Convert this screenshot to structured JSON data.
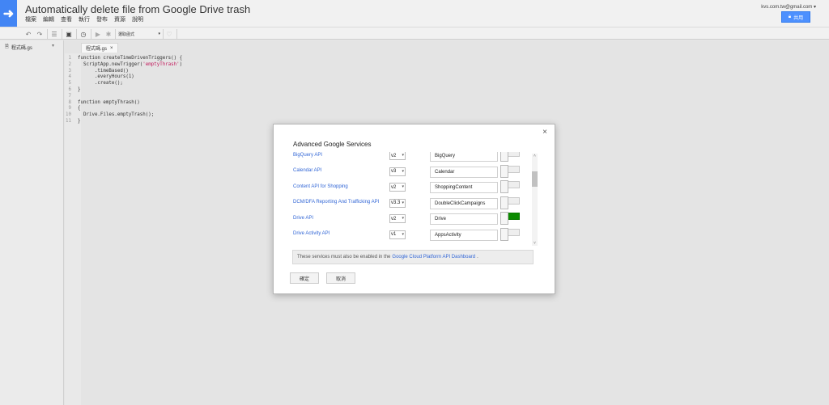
{
  "app": {
    "title": "Automatically delete file from Google Drive trash",
    "account": "kvs.com.tw@gmail.com",
    "share_label": "共用",
    "logo_icon": "arrow-right-icon",
    "brand_color": "#4285f4"
  },
  "menu": [
    "檔案",
    "編輯",
    "查看",
    "執行",
    "發布",
    "資源",
    "說明"
  ],
  "toolbar": {
    "function_select": "選取函式"
  },
  "sidebar": {
    "file_name": "程式碼.gs"
  },
  "editor": {
    "tab_label": "程式碼.gs",
    "tab_close": "×",
    "lines": [
      {
        "n": "1",
        "pre": "function createTimeDrivenTriggers() {",
        "str": "",
        "post": ""
      },
      {
        "n": "2",
        "pre": "  ScriptApp.newTrigger(",
        "str": "'emptyThrash'",
        "post": ")"
      },
      {
        "n": "3",
        "pre": "      .timeBased()",
        "str": "",
        "post": ""
      },
      {
        "n": "4",
        "pre": "      .everyHours(1)",
        "str": "",
        "post": ""
      },
      {
        "n": "5",
        "pre": "      .create();",
        "str": "",
        "post": ""
      },
      {
        "n": "6",
        "pre": "}",
        "str": "",
        "post": ""
      },
      {
        "n": "7",
        "pre": "",
        "str": "",
        "post": ""
      },
      {
        "n": "8",
        "pre": "function emptyThrash()",
        "str": "",
        "post": ""
      },
      {
        "n": "9",
        "pre": "{",
        "str": "",
        "post": ""
      },
      {
        "n": "10",
        "pre": "  Drive.Files.emptyTrash();",
        "str": "",
        "post": ""
      },
      {
        "n": "11",
        "pre": "}",
        "str": "",
        "post": ""
      }
    ]
  },
  "dialog": {
    "title": "Advanced Google Services",
    "close": "×",
    "services": [
      {
        "name": "BigQuery API",
        "version": "v2",
        "id": "BigQuery",
        "enabled": false
      },
      {
        "name": "Calendar API",
        "version": "v3",
        "id": "Calendar",
        "enabled": false
      },
      {
        "name": "Content API for Shopping",
        "version": "v2",
        "id": "ShoppingContent",
        "enabled": false
      },
      {
        "name": "DCM/DFA Reporting And Trafficking API",
        "version": "v3.3",
        "id": "DoubleClickCampaigns",
        "enabled": false
      },
      {
        "name": "Drive API",
        "version": "v2",
        "id": "Drive",
        "enabled": true
      },
      {
        "name": "Drive Activity API",
        "version": "v1",
        "id": "AppsActivity",
        "enabled": false
      }
    ],
    "notice_prefix": "These services must also be enabled in the",
    "notice_link": "Google Cloud Platform API Dashboard",
    "notice_suffix": ".",
    "ok_label": "確定",
    "cancel_label": "取消",
    "enabled_color": "#0b8a00"
  }
}
